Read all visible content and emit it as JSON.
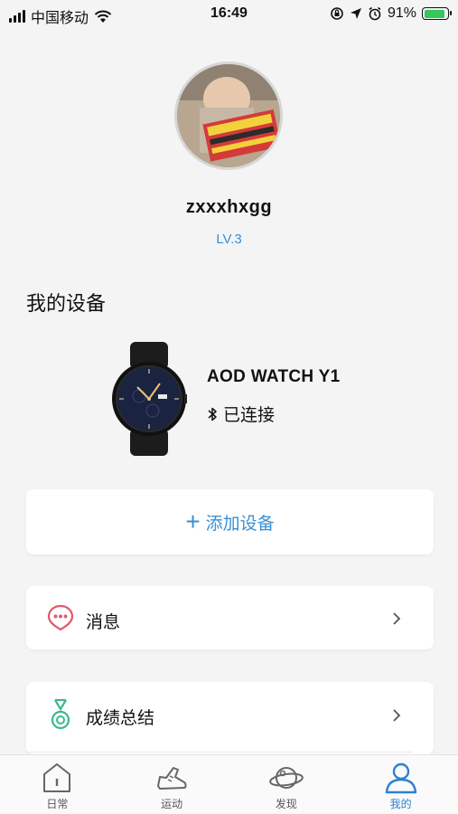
{
  "status_bar": {
    "carrier": "中国移动",
    "time": "16:49",
    "battery_percent": "91%",
    "battery_level": 0.91
  },
  "profile": {
    "username": "zxxxhxgg",
    "level": "LV.3"
  },
  "devices_section": {
    "title": "我的设备",
    "device": {
      "name": "AOD WATCH Y1",
      "status": "已连接"
    }
  },
  "add_device": {
    "label": "添加设备"
  },
  "menu": {
    "messages_label": "消息",
    "summary_label": "成绩总结"
  },
  "tabs": [
    {
      "label": "日常"
    },
    {
      "label": "运动"
    },
    {
      "label": "发现"
    },
    {
      "label": "我的"
    }
  ],
  "colors": {
    "accent": "#3b8fd2",
    "message_icon": "#e05a6e",
    "medal_icon": "#3cb88a"
  }
}
